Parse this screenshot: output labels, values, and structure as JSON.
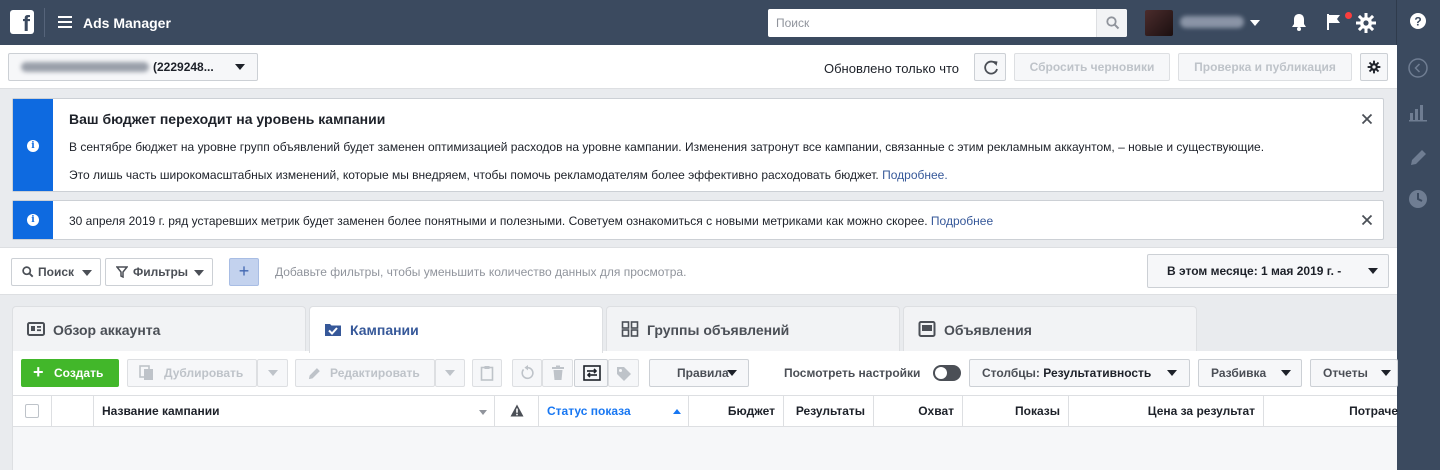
{
  "app": {
    "title": "Ads Manager",
    "logo_letter": "f"
  },
  "search": {
    "placeholder": "Поиск"
  },
  "account": {
    "id_label": "(2229248..."
  },
  "status": {
    "updated": "Обновлено только что",
    "reset_drafts": "Сбросить черновики",
    "review_publish": "Проверка и публикация"
  },
  "notices": [
    {
      "title": "Ваш бюджет переходит на уровень кампании",
      "line1": "В сентябре бюджет на уровне групп объявлений будет заменен оптимизацией расходов на уровне кампании. Изменения затронут все кампании, связанные с этим рекламным аккаунтом, – новые и существующие.",
      "line2": "Это лишь часть широкомасштабных изменений, которые мы внедряем, чтобы помочь рекламодателям более эффективно расходовать бюджет.",
      "link": "Подробнее."
    },
    {
      "line1": "30 апреля 2019 г. ряд устаревших метрик будет заменен более понятными и полезными. Советуем ознакомиться с новыми метриками как можно скорее.",
      "link": "Подробнее"
    }
  ],
  "filters": {
    "search_label": "Поиск",
    "filters_label": "Фильтры",
    "hint": "Добавьте фильтры, чтобы уменьшить количество данных для просмотра.",
    "date_range": "В этом месяце: 1 мая 2019 г. -"
  },
  "tabs": [
    {
      "label": "Обзор аккаунта",
      "active": false
    },
    {
      "label": "Кампании",
      "active": true
    },
    {
      "label": "Группы объявлений",
      "active": false
    },
    {
      "label": "Объявления",
      "active": false
    }
  ],
  "toolbar": {
    "create": "Создать",
    "duplicate": "Дублировать",
    "edit": "Редактировать",
    "rules": "Правила",
    "view_settings": "Посмотреть настройки",
    "columns_prefix": "Столбцы:",
    "columns_value": "Результативность",
    "breakdown": "Разбивка",
    "reports": "Отчеты"
  },
  "table": {
    "columns": [
      "Название кампании",
      "Статус показа",
      "Бюджет",
      "Результаты",
      "Охват",
      "Показы",
      "Цена за результат",
      "Потраче"
    ]
  },
  "colors": {
    "topbar": "#3b4a5f",
    "notice_accent": "#0e6ae0",
    "create_green": "#42b72a",
    "link": "#365899",
    "active_sort": "#1877f2"
  }
}
